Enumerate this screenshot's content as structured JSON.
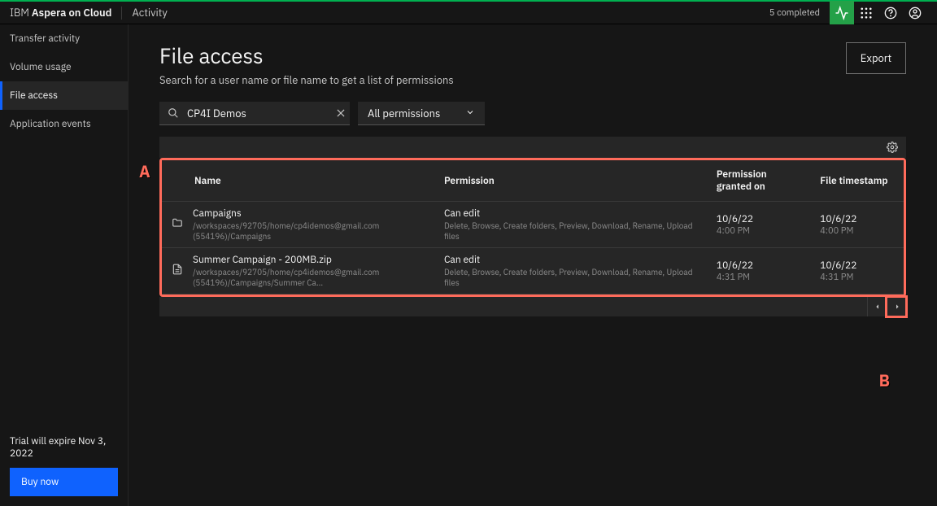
{
  "brand_prefix": "IBM ",
  "brand_name": "Aspera on Cloud",
  "top_nav_label": "Activity",
  "completed_status": "5 completed",
  "sidebar": {
    "items": [
      {
        "label": "Transfer activity"
      },
      {
        "label": "Volume usage"
      },
      {
        "label": "File access"
      },
      {
        "label": "Application events"
      }
    ]
  },
  "trial": {
    "text": "Trial will expire Nov 3, 2022",
    "button": "Buy now"
  },
  "header": {
    "title": "File access",
    "subtitle": "Search for a user name or file name to get a list of permissions",
    "export": "Export"
  },
  "search": {
    "value": "CP4I Demos"
  },
  "filter": {
    "label": "All permissions"
  },
  "columns": {
    "name": "Name",
    "permission": "Permission",
    "granted": "Permission granted on",
    "timestamp": "File timestamp"
  },
  "rows": [
    {
      "icon": "folder",
      "name": "Campaigns",
      "path": "/workspaces/92705/home/cp4idemos@gmail.com (554196)/Campaigns",
      "perm": "Can edit",
      "perm_detail": "Delete, Browse, Create folders, Preview, Download, Rename, Upload files",
      "granted_date": "10/6/22",
      "granted_time": "4:00 PM",
      "ts_date": "10/6/22",
      "ts_time": "4:00 PM"
    },
    {
      "icon": "file",
      "name": "Summer Campaign - 200MB.zip",
      "path": "/workspaces/92705/home/cp4idemos@gmail.com (554196)/Campaigns/Summer Ca...",
      "perm": "Can edit",
      "perm_detail": "Delete, Browse, Create folders, Preview, Download, Rename, Upload files",
      "granted_date": "10/6/22",
      "granted_time": "4:31 PM",
      "ts_date": "10/6/22",
      "ts_time": "4:31 PM"
    }
  ],
  "annotations": {
    "a": "A",
    "b": "B"
  }
}
